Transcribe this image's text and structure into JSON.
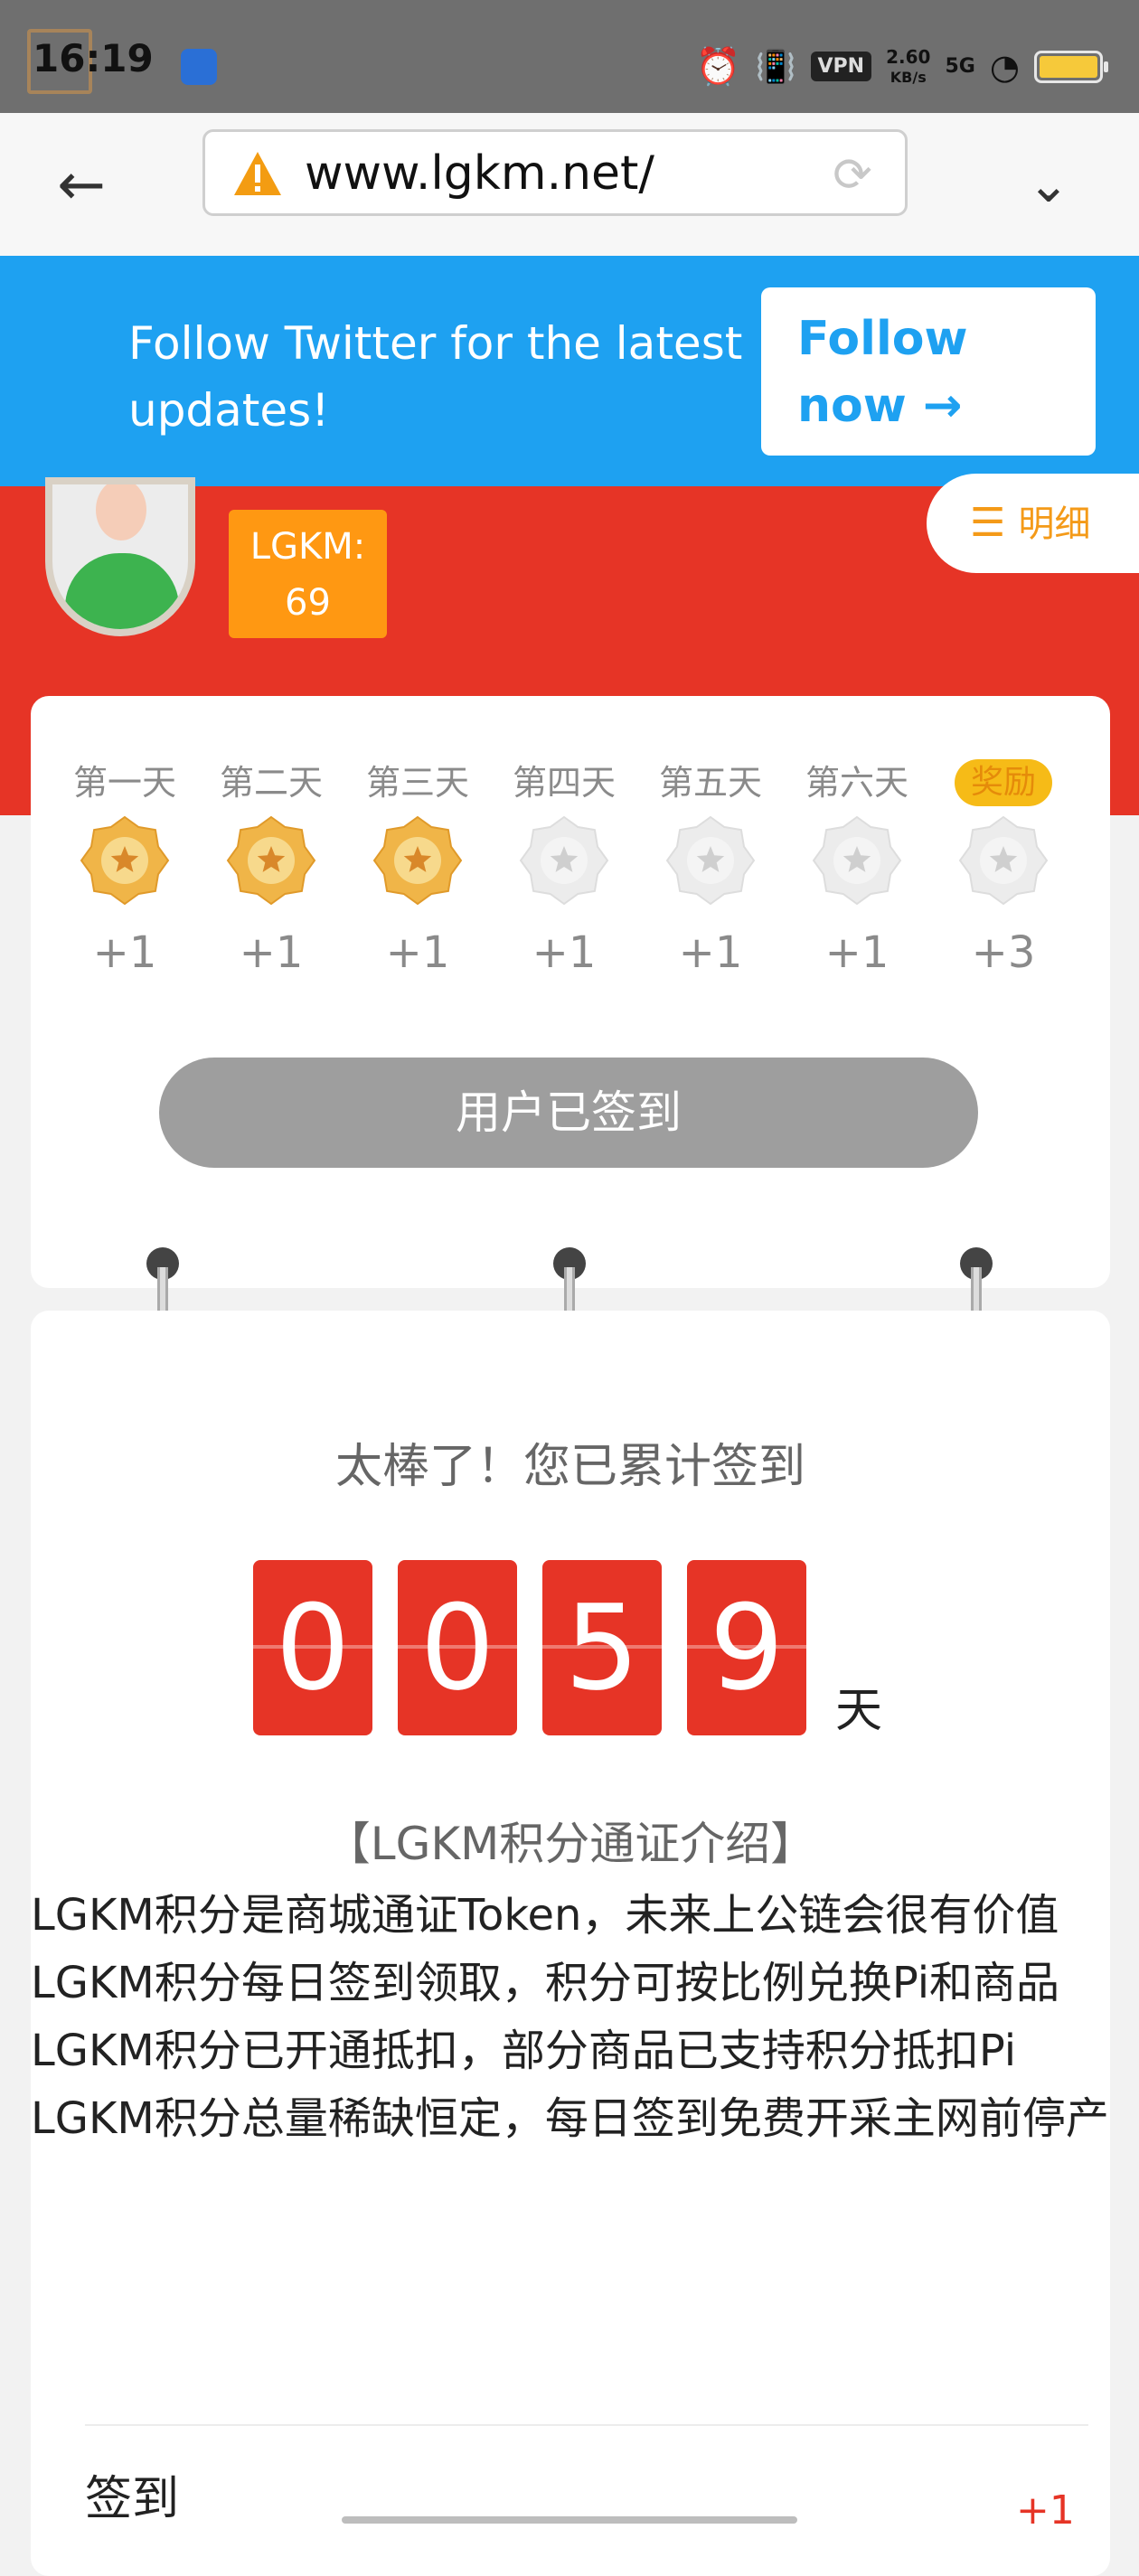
{
  "status_bar": {
    "time": "16:19",
    "network_speed_value": "2.60",
    "network_speed_unit": "KB/s",
    "vpn_label": "VPN",
    "signal_label": "5G"
  },
  "browser": {
    "url": "www.lgkm.net/"
  },
  "twitter_banner": {
    "text": "Follow Twitter for the latest updates!",
    "button_label": "Follow now →",
    "bg_color": "#1ea1f1"
  },
  "header": {
    "points_label": "LGKM:",
    "points_value": "69",
    "details_label": "明细",
    "accent_color": "#e63426"
  },
  "checkin": {
    "days": [
      {
        "label": "第一天",
        "points": "+1",
        "completed": true
      },
      {
        "label": "第二天",
        "points": "+1",
        "completed": true
      },
      {
        "label": "第三天",
        "points": "+1",
        "completed": true
      },
      {
        "label": "第四天",
        "points": "+1",
        "completed": false
      },
      {
        "label": "第五天",
        "points": "+1",
        "completed": false
      },
      {
        "label": "第六天",
        "points": "+1",
        "completed": false
      },
      {
        "label": "奖励",
        "points": "+3",
        "completed": false,
        "reward": true
      }
    ],
    "button_label": "用户已签到"
  },
  "counter": {
    "title": "太棒了！您已累计签到",
    "digits": [
      "0",
      "0",
      "5",
      "9"
    ],
    "unit": "天"
  },
  "intro": {
    "title": "【LGKM积分通证介绍】",
    "lines": [
      "LGKM积分是商城通证Token，未来上公链会很有价值",
      "LGKM积分每日签到领取，积分可按比例兑换Pi和商品",
      "LGKM积分已开通抵扣，部分商品已支持积分抵扣Pi",
      "LGKM积分总量稀缺恒定，每日签到免费开采主网前停产"
    ]
  },
  "history": {
    "label": "签到",
    "value": "+1"
  }
}
